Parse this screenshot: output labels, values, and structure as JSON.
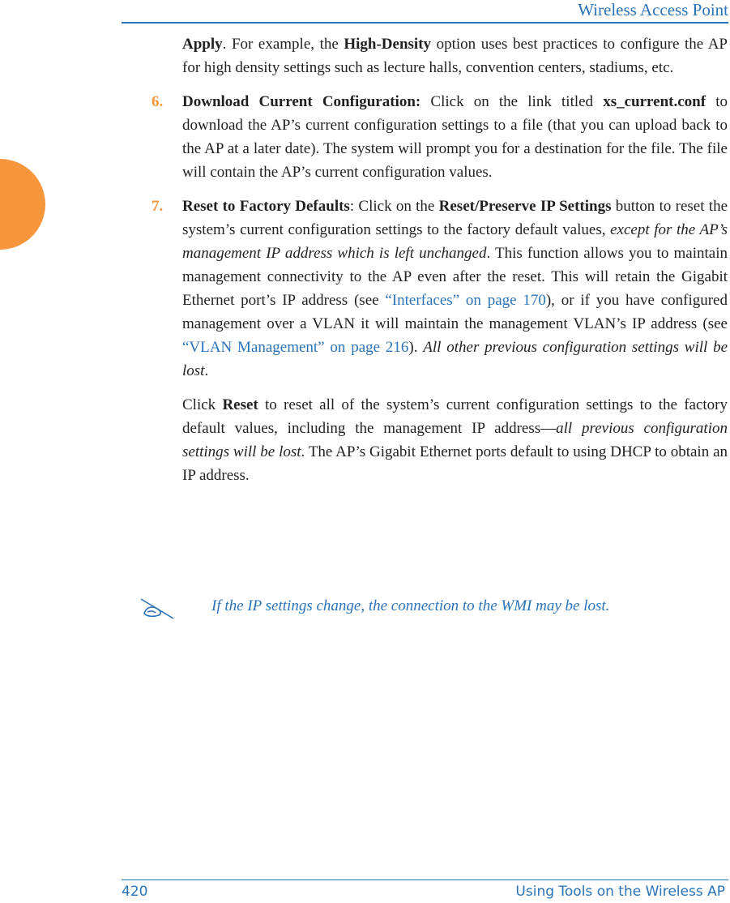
{
  "header": {
    "title": "Wireless Access Point"
  },
  "intro": {
    "apply": "Apply",
    "t1": ". For example, the ",
    "high_density": "High-Density",
    "t2": " option uses best practices to configure the AP for high density settings such as lecture halls, convention centers, stadiums, etc."
  },
  "item6": {
    "number": "6.",
    "title": "Download Current Configuration:",
    "t1": " Click on the link titled ",
    "filename": "xs_current.conf",
    "t2": " to download the AP’s current configuration settings to a file (that you can upload back to the AP at a later date). The system will prompt you for a destination for the file. The file will contain the AP’s current configuration values."
  },
  "item7": {
    "number": "7.",
    "title": "Reset to Factory Defaults",
    "t1": ": Click on the ",
    "button_name": "Reset/Preserve IP Settings",
    "t2": " button to reset the system’s current configuration settings to the factory default values, ",
    "italic1": "except for the AP’s management IP address which is left unchanged",
    "t3": ". This function allows you to maintain management connectivity to the AP even after the reset. This will retain the Gigabit Ethernet port’s IP address (see ",
    "link1": "“Interfaces” on page 170",
    "t4": "), or if you have configured management over a VLAN it will maintain the management VLAN’s IP address (see ",
    "link2": "“VLAN Management” on page 216",
    "t5": "). ",
    "italic2": "All other previous configuration settings will be lost",
    "t6": "."
  },
  "reset_para": {
    "t1": "Click ",
    "reset": "Reset",
    "t2": " to reset all of the system’s current configuration settings to the factory default values, including the management IP address—",
    "italic": "all previous configuration settings will be lost",
    "t3": ". The AP’s Gigabit Ethernet ports default to using DHCP to obtain an IP address."
  },
  "note": {
    "icon": "note-pencil-icon",
    "text": "If the IP settings change, the connection to the WMI may be lost."
  },
  "footer": {
    "page_number": "420",
    "section_title": "Using Tools on the Wireless AP"
  },
  "colors": {
    "accent_blue": "#2a73b8",
    "accent_orange": "#f7963a"
  }
}
